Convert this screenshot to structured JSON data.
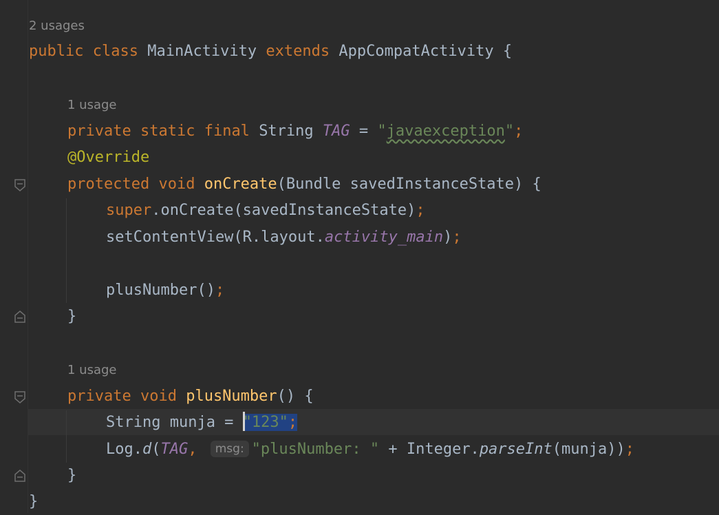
{
  "colors": {
    "background": "#2b2b2b",
    "keyword": "#cc7832",
    "annotation": "#bbb529",
    "method_declaration": "#ffc66d",
    "string": "#6a8759",
    "constant": "#9876aa",
    "default_text": "#a9b7c6",
    "usage_hint": "#8c8c8c",
    "selection": "#214283"
  },
  "hints": {
    "class_usages": "2 usages",
    "tag_usages": "1 usage",
    "method_usages": "1 usage",
    "msg_param": "msg:"
  },
  "code": {
    "l1": {
      "kw_public": "public",
      "kw_class": "class",
      "class_name": "MainActivity",
      "kw_extends": "extends",
      "super_class": "AppCompatActivity",
      "brace": "{"
    },
    "l2": {
      "kw_private": "private",
      "kw_static": "static",
      "kw_final": "final",
      "type": "String",
      "const_name": "TAG",
      "eq": "=",
      "q1": "\"",
      "str_value": "javaexception",
      "q2": "\"",
      "semi": ";"
    },
    "l3": {
      "annotation": "@Override"
    },
    "l4": {
      "kw_protected": "protected",
      "kw_void": "void",
      "method": "onCreate",
      "params": "(Bundle savedInstanceState) {"
    },
    "l5": {
      "kw_super": "super",
      "call": ".onCreate(savedInstanceState)",
      "semi": ";"
    },
    "l6": {
      "call": "setContentView(R.layout.",
      "field": "activity_main",
      "close": ")",
      "semi": ";"
    },
    "l7": {
      "call": "plusNumber()",
      "semi": ";"
    },
    "l8": {
      "brace": "}"
    },
    "l9": {
      "kw_private": "private",
      "kw_void": "void",
      "method": "plusNumber",
      "rest": "() {"
    },
    "l10": {
      "decl": "String munja = ",
      "str": "\"123\"",
      "semi": ";"
    },
    "l11": {
      "log": "Log.",
      "d": "d",
      "open": "(",
      "tag": "TAG",
      "comma": ",",
      "str": "\"plusNumber: \"",
      "plus": " + Integer.",
      "parse": "parseInt",
      "args": "(munja))",
      "semi": ";"
    },
    "l12": {
      "brace": "}"
    },
    "l13": {
      "brace": "}"
    }
  }
}
